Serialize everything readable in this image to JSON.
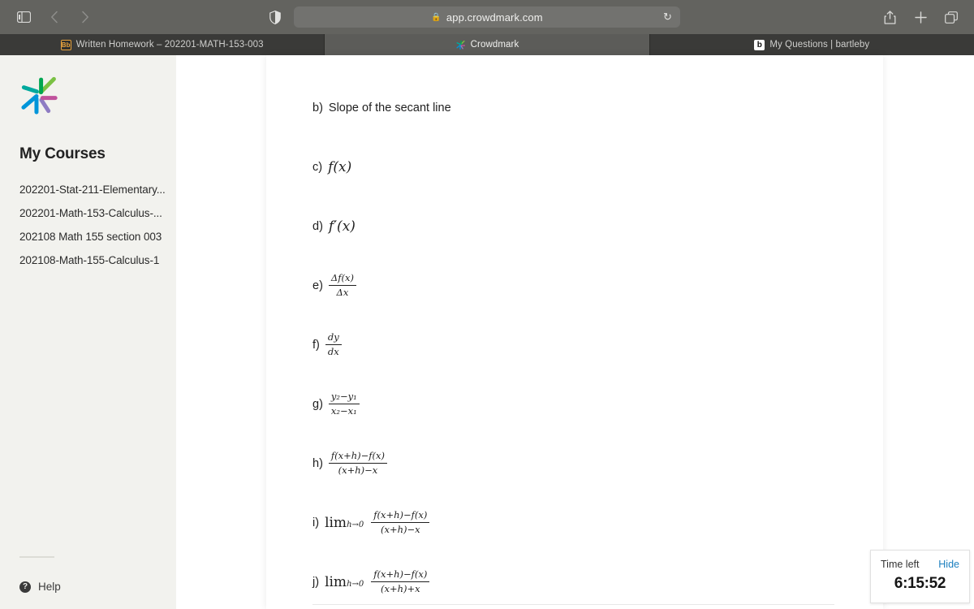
{
  "browser": {
    "nav": {
      "sidebar_toggle_icon": "sidebar-toggle-icon",
      "back_icon": "chevron-left-icon",
      "forward_icon": "chevron-right-icon",
      "shield_icon": "privacy-shield-icon"
    },
    "address_bar": {
      "url": "app.crowdmark.com",
      "lock_icon": "lock-icon",
      "reload_icon": "reload-icon"
    },
    "actions": {
      "share_icon": "share-icon",
      "new_tab_icon": "plus-icon",
      "tab_overview_icon": "tab-overview-icon"
    },
    "tabs": [
      {
        "label": "Written Homework – 202201-MATH-153-003",
        "favicon": "blackboard-icon",
        "active": false
      },
      {
        "label": "Crowdmark",
        "favicon": "crowdmark-logo-icon",
        "active": true
      },
      {
        "label": "My Questions | bartleby",
        "favicon": "bartleby-icon",
        "active": false
      }
    ]
  },
  "sidebar": {
    "logo_icon": "crowdmark-logo",
    "title": "My Courses",
    "courses": [
      "202201-Stat-211-Elementary...",
      "202201-Math-153-Calculus-...",
      "202108 Math 155 section 003",
      "202108-Math-155-Calculus-1"
    ],
    "help": {
      "label": "Help",
      "icon": "question-circle-icon"
    }
  },
  "questions": [
    {
      "label": "b)",
      "kind": "text",
      "text": "Slope of the secant line"
    },
    {
      "label": "c)",
      "kind": "math",
      "math": "f(x)"
    },
    {
      "label": "d)",
      "kind": "math",
      "math": "f′(x)"
    },
    {
      "label": "e)",
      "kind": "fraction",
      "numerator": "Δf(x)",
      "denominator": "Δx"
    },
    {
      "label": "f)",
      "kind": "fraction",
      "numerator": "dy",
      "denominator": "dx"
    },
    {
      "label": "g)",
      "kind": "fraction",
      "numerator": "y₂−y₁",
      "denominator": "x₂−x₁"
    },
    {
      "label": "h)",
      "kind": "fraction",
      "numerator": "f(x+h)−f(x)",
      "denominator": "(x+h)−x"
    },
    {
      "label": "i)",
      "kind": "limit",
      "limit": "lim",
      "sub": "h→0",
      "numerator": "f(x+h)−f(x)",
      "denominator": "(x+h)−x"
    },
    {
      "label": "j)",
      "kind": "limit",
      "limit": "lim",
      "sub": "h→0",
      "numerator": "f(x+h)−f(x)",
      "denominator": "(x+h)+x"
    }
  ],
  "timer": {
    "label": "Time left",
    "hide_label": "Hide",
    "value": "6:15:52",
    "link_color": "#1b7fbf"
  },
  "colors": {
    "sidebar_bg": "#f2f2ee",
    "chrome_bg": "#63635f",
    "tab_inactive": "#3a3a38",
    "tab_active": "#5c5c59",
    "text": "#1f1f1f"
  }
}
